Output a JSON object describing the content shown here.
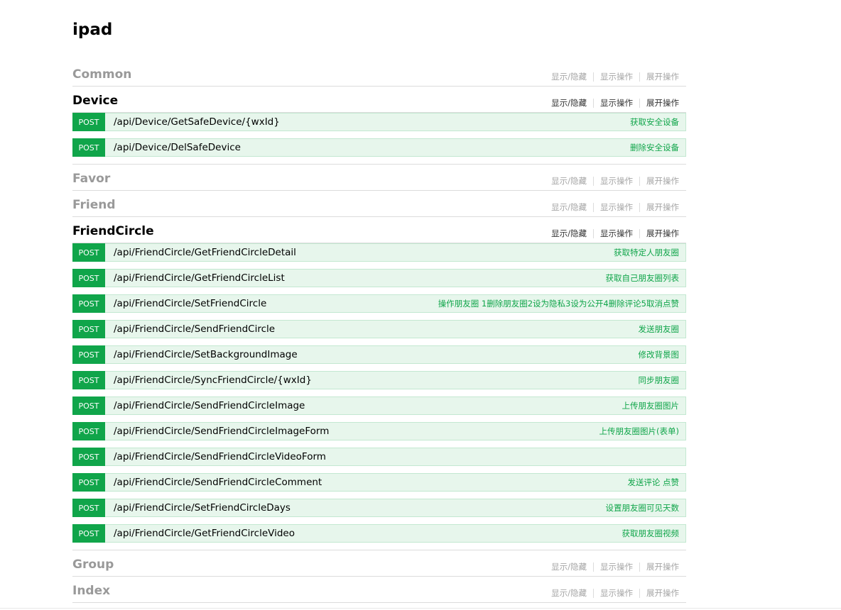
{
  "app_title": "ipad",
  "options": {
    "toggle": "显示/隐藏",
    "list": "显示操作",
    "expand": "展开操作"
  },
  "resources": [
    {
      "name": "Common",
      "expanded": false,
      "operations": []
    },
    {
      "name": "Device",
      "expanded": true,
      "operations": [
        {
          "method": "POST",
          "path": "/api/Device/GetSafeDevice/{wxId}",
          "summary": "获取安全设备"
        },
        {
          "method": "POST",
          "path": "/api/Device/DelSafeDevice",
          "summary": "删除安全设备"
        }
      ]
    },
    {
      "name": "Favor",
      "expanded": false,
      "operations": []
    },
    {
      "name": "Friend",
      "expanded": false,
      "operations": []
    },
    {
      "name": "FriendCircle",
      "expanded": true,
      "operations": [
        {
          "method": "POST",
          "path": "/api/FriendCircle/GetFriendCircleDetail",
          "summary": "获取特定人朋友圈"
        },
        {
          "method": "POST",
          "path": "/api/FriendCircle/GetFriendCircleList",
          "summary": "获取自己朋友圈列表"
        },
        {
          "method": "POST",
          "path": "/api/FriendCircle/SetFriendCircle",
          "summary": "操作朋友圈 1删除朋友圈2设为隐私3设为公开4删除评论5取消点赞"
        },
        {
          "method": "POST",
          "path": "/api/FriendCircle/SendFriendCircle",
          "summary": "发送朋友圈"
        },
        {
          "method": "POST",
          "path": "/api/FriendCircle/SetBackgroundImage",
          "summary": "修改背景图"
        },
        {
          "method": "POST",
          "path": "/api/FriendCircle/SyncFriendCircle/{wxId}",
          "summary": "同步朋友圈"
        },
        {
          "method": "POST",
          "path": "/api/FriendCircle/SendFriendCircleImage",
          "summary": "上传朋友圈图片"
        },
        {
          "method": "POST",
          "path": "/api/FriendCircle/SendFriendCircleImageForm",
          "summary": "上传朋友圈图片(表单)"
        },
        {
          "method": "POST",
          "path": "/api/FriendCircle/SendFriendCircleVideoForm",
          "summary": ""
        },
        {
          "method": "POST",
          "path": "/api/FriendCircle/SendFriendCircleComment",
          "summary": "发送评论 点赞"
        },
        {
          "method": "POST",
          "path": "/api/FriendCircle/SetFriendCircleDays",
          "summary": "设置朋友圈可见天数"
        },
        {
          "method": "POST",
          "path": "/api/FriendCircle/GetFriendCircleVideo",
          "summary": "获取朋友圈视频"
        }
      ]
    },
    {
      "name": "Group",
      "expanded": false,
      "operations": []
    },
    {
      "name": "Index",
      "expanded": false,
      "operations": []
    }
  ]
}
